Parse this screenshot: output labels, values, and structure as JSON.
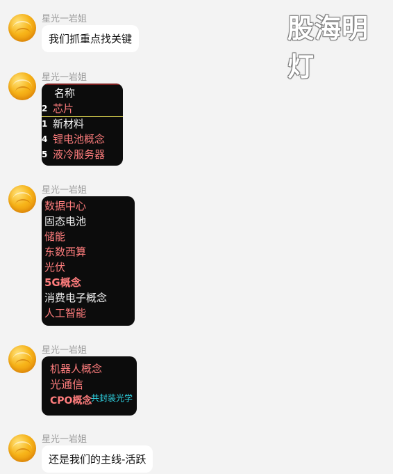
{
  "watermark": "股海明灯",
  "messages": [
    {
      "sender": "星光一岩姐",
      "type": "text",
      "text": "我们抓重点找关键"
    },
    {
      "sender": "星光一岩姐",
      "type": "image",
      "rows": [
        {
          "num": "",
          "text": "名称",
          "color": "white"
        },
        {
          "num": "2",
          "text": "芯片",
          "color": "red"
        },
        {
          "num": "1",
          "text": "新材料",
          "color": "white"
        },
        {
          "num": "4",
          "text": "锂电池概念",
          "color": "red"
        },
        {
          "num": "5",
          "text": "液冷服务器",
          "color": "red"
        }
      ]
    },
    {
      "sender": "星光一岩姐",
      "type": "image",
      "rows": [
        {
          "text": "数据中心",
          "color": "red"
        },
        {
          "text": "固态电池",
          "color": "white"
        },
        {
          "text": "储能",
          "color": "red"
        },
        {
          "text": "东数西算",
          "color": "red"
        },
        {
          "text": "光伏",
          "color": "red"
        },
        {
          "text": "5G概念",
          "color": "red"
        },
        {
          "text": "消费电子概念",
          "color": "white"
        },
        {
          "text": "人工智能",
          "color": "red"
        }
      ]
    },
    {
      "sender": "星光一岩姐",
      "type": "image",
      "rows": [
        {
          "text": "机器人概念",
          "color": "red"
        },
        {
          "text": "光通信",
          "color": "red"
        },
        {
          "text": "CPO概念",
          "color": "red"
        }
      ],
      "annotation": "共封装光学"
    },
    {
      "sender": "星光一岩姐",
      "type": "text",
      "text": "还是我们的主线-活跃"
    }
  ]
}
